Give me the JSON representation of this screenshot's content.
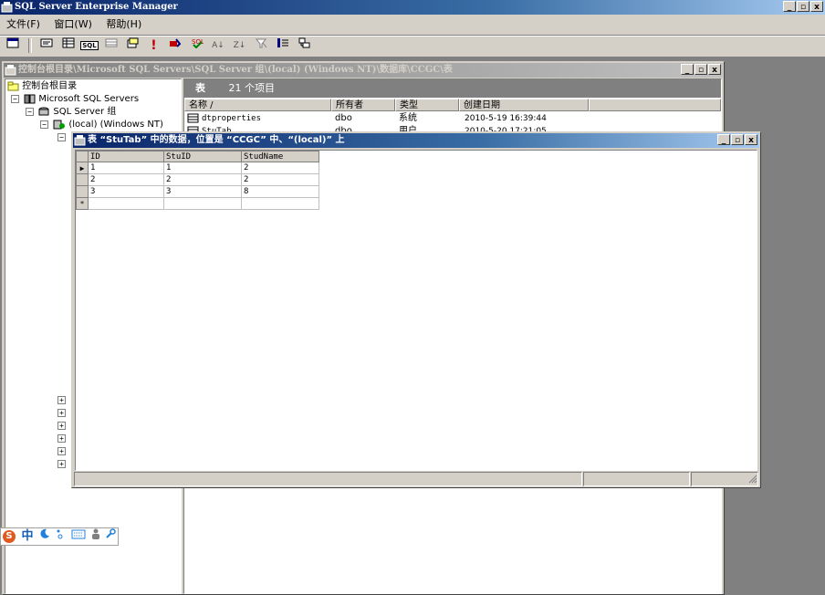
{
  "app": {
    "title": "SQL Server Enterprise Manager",
    "window_buttons": [
      "_",
      "▫",
      "x"
    ]
  },
  "menu": [
    {
      "label": "文件(F)"
    },
    {
      "label": "窗口(W)"
    },
    {
      "label": "帮助(H)"
    }
  ],
  "toolbar": {
    "icons": [
      "new-window-icon",
      "details-pane-icon",
      "grid-pane-icon",
      "sql-pane-icon",
      "results-pane-icon",
      "query-type-icon",
      "run-icon",
      "verify-sql-icon",
      "cancel-icon",
      "sort-asc-icon",
      "sort-desc-icon",
      "remove-filter-icon",
      "group-by-icon",
      "add-table-icon"
    ],
    "labels": {
      "sql": "SQL",
      "run": "!",
      "sort_asc": "A↓",
      "sort_desc": "Z↓"
    }
  },
  "console": {
    "title": "控制台根目录\\Microsoft SQL Servers\\SQL Server 组\\(local) (Windows NT)\\数据库\\CCGC\\表",
    "tree": {
      "root": "控制台根目录",
      "ms_sql": "Microsoft SQL Servers",
      "group": "SQL Server 组",
      "local": "(local) (Windows NT)"
    },
    "list_header": {
      "label": "表",
      "count": "21 个项目"
    },
    "columns": [
      "名称 /",
      "所有者",
      "类型",
      "创建日期"
    ],
    "rows": [
      {
        "name": "dtproperties",
        "owner": "dbo",
        "type": "系统",
        "date": "2010-5-19 16:39:44"
      },
      {
        "name": "StuTab",
        "owner": "dbo",
        "type": "用户",
        "date": "2010-5-20 17:21:05"
      }
    ]
  },
  "data_window": {
    "title": "表 “StuTab” 中的数据，位置是 “CCGC” 中、“(local)” 上",
    "columns": [
      "ID",
      "StuID",
      "StudName"
    ],
    "rows": [
      [
        "1",
        "1",
        "2"
      ],
      [
        "2",
        "2",
        "2"
      ],
      [
        "3",
        "3",
        "8"
      ]
    ],
    "current_marker": "▶",
    "new_marker": "*"
  },
  "ime": {
    "logo": "S",
    "lang": "中",
    "items": [
      "moon-icon",
      "punct-icon",
      "keyboard-icon",
      "user-icon",
      "wrench-icon"
    ]
  },
  "colors": {
    "title_active": "#0a246a",
    "face": "#d4d0c8",
    "workspace": "#808080"
  }
}
